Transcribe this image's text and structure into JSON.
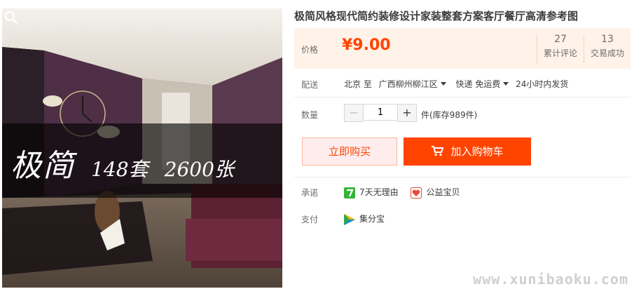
{
  "product": {
    "title": "极简风格现代简约装修设计家装整套方案客厅餐厅高清参考图",
    "image": {
      "banner_title": "极简",
      "banner_sets": "148套",
      "banner_count": "2600张",
      "zoom_icon": "magnifier-icon"
    }
  },
  "price": {
    "label": "价格",
    "value": "¥9.00",
    "reviews_count": "27",
    "reviews_label": "累计评论",
    "deals_count": "13",
    "deals_label": "交易成功"
  },
  "shipping": {
    "label": "配送",
    "from": "北京 至",
    "to": "广西柳州柳江区",
    "method": "快递 免运费",
    "dispatch": "24小时内发货"
  },
  "quantity": {
    "label": "数量",
    "minus": "−",
    "value": "1",
    "plus": "+",
    "stock": "件(库存989件)"
  },
  "actions": {
    "buy_now": "立即购买",
    "add_to_cart": "加入购物车",
    "cart_icon": "shopping-cart-icon"
  },
  "promise": {
    "label": "承诺",
    "items": [
      {
        "icon": "seven-day-return-icon",
        "text": "7天无理由"
      },
      {
        "icon": "charity-heart-icon",
        "text": "公益宝贝"
      }
    ]
  },
  "payment": {
    "label": "支付",
    "method": "集分宝",
    "icon": "jifenbao-icon"
  },
  "watermark": "www.xunibaoku.com",
  "colors": {
    "accent": "#ff4400",
    "price_bg": "#fff2e8",
    "buy_bg": "#ffeded"
  }
}
